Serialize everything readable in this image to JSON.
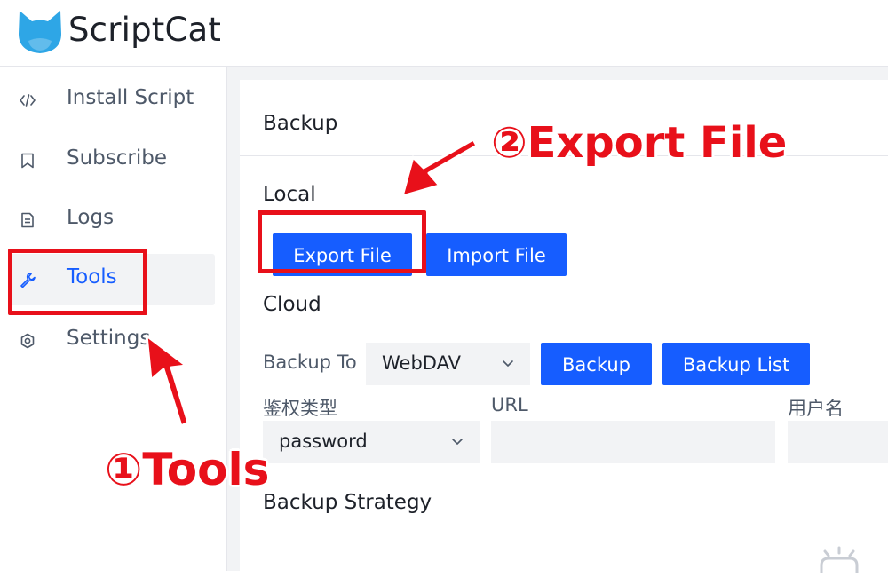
{
  "app": {
    "title": "ScriptCat"
  },
  "sidebar": {
    "items": [
      {
        "label": "Install Script",
        "icon": "code-icon",
        "active": false
      },
      {
        "label": "Subscribe",
        "icon": "bookmark-icon",
        "active": false
      },
      {
        "label": "Logs",
        "icon": "document-icon",
        "active": false
      },
      {
        "label": "Tools",
        "icon": "wrench-icon",
        "active": true
      },
      {
        "label": "Settings",
        "icon": "gear-icon",
        "active": false
      }
    ]
  },
  "main": {
    "card_title": "Backup",
    "local": {
      "title": "Local",
      "export_label": "Export File",
      "import_label": "Import File"
    },
    "cloud": {
      "title": "Cloud",
      "backup_to_label": "Backup To",
      "backup_to_value": "WebDAV",
      "backup_label": "Backup",
      "backup_list_label": "Backup List",
      "auth_type_label": "鉴权类型",
      "auth_type_value": "password",
      "url_label": "URL",
      "username_label": "用户名"
    },
    "strategy": {
      "title": "Backup Strategy"
    }
  },
  "annotations": {
    "step1": "①Tools",
    "step2": "②Export File"
  },
  "colors": {
    "primary": "#165dff",
    "annotation": "#e8101a",
    "logo": "#2ea6e6"
  }
}
